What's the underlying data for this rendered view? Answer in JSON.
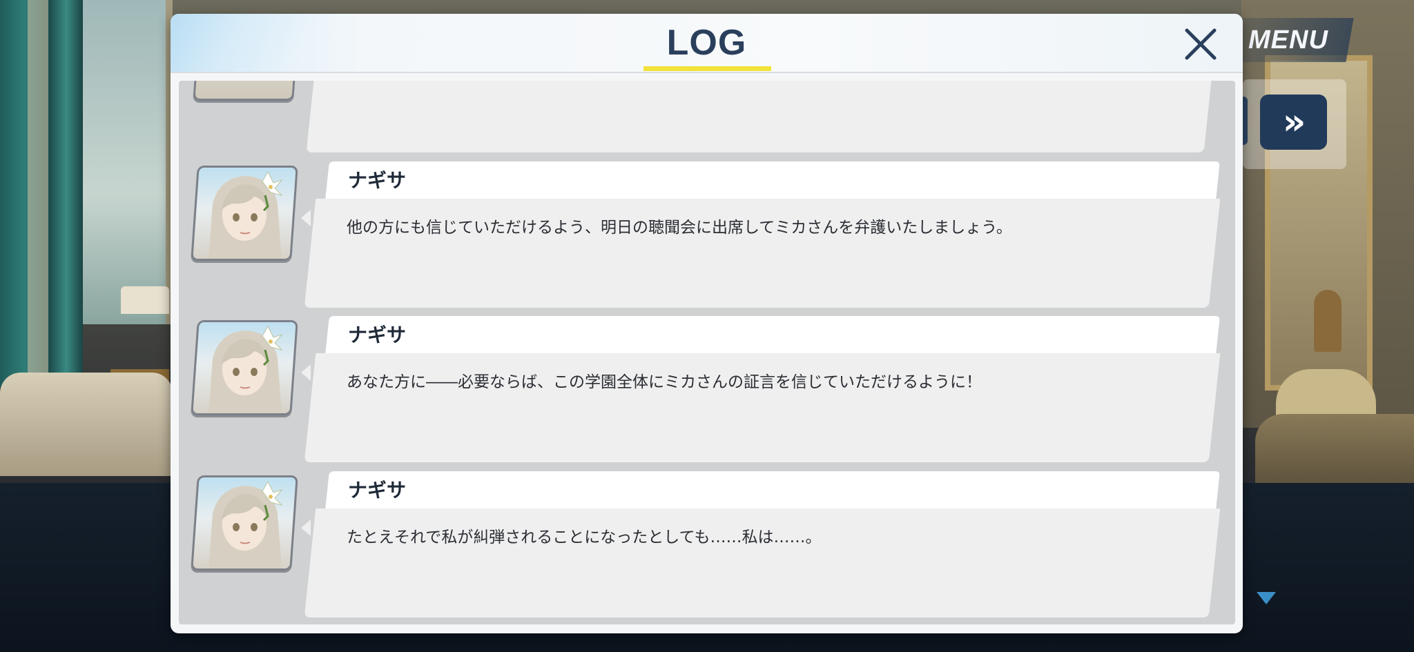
{
  "hud": {
    "menu_label": "MENU",
    "fast_forward_label": "»"
  },
  "log": {
    "title": "LOG",
    "accent_color": "#f2e23a",
    "entries": [
      {
        "speaker": "ナギサ",
        "message": "他の方にも信じていただけるよう、明日の聴聞会に出席してミカさんを弁護いたしましょう。",
        "avatar": "nagisa-portrait"
      },
      {
        "speaker": "ナギサ",
        "message": "あなた方に――必要ならば、この学園全体にミカさんの証言を信じていただけるように！",
        "avatar": "nagisa-portrait"
      },
      {
        "speaker": "ナギサ",
        "message": "たとえそれで私が糾弾されることになったとしても……私は……。",
        "avatar": "nagisa-portrait"
      }
    ]
  },
  "icons": {
    "close": "close-icon",
    "fast_forward": "fast-forward-icon",
    "scroll_down": "scroll-down-icon"
  }
}
